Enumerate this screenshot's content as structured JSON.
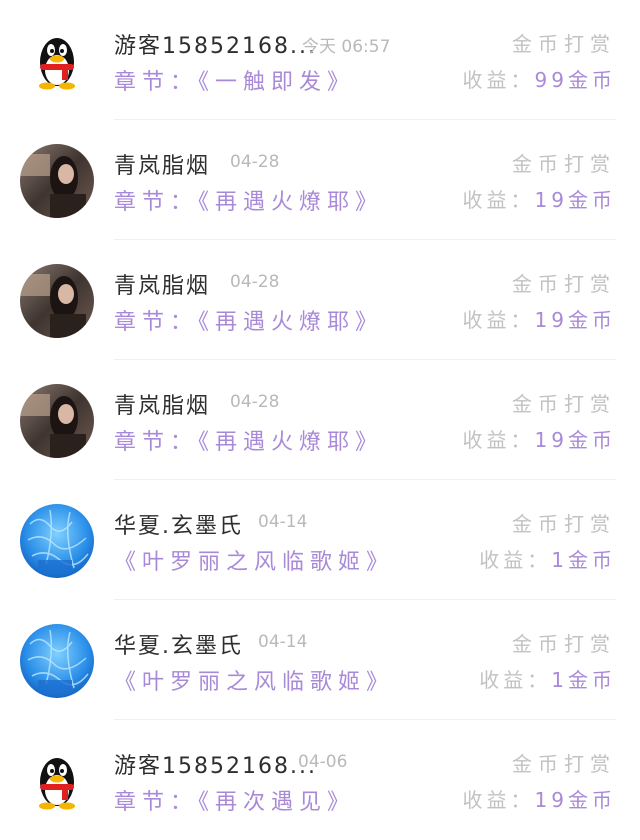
{
  "items": [
    {
      "avatar": "qq-penguin-icon",
      "name": "游客15852168...",
      "date": "今天 06:57",
      "chapter": "章节：《一触即发》",
      "type": "金币打赏",
      "earn_label": "收益：",
      "earn_amount": "99金币"
    },
    {
      "avatar": "photo-girl",
      "name": "青岚脂烟",
      "date": "04-28",
      "chapter": "章节：《再遇火燎耶》",
      "type": "金币打赏",
      "earn_label": "收益：",
      "earn_amount": "19金币"
    },
    {
      "avatar": "photo-girl",
      "name": "青岚脂烟",
      "date": "04-28",
      "chapter": "章节：《再遇火燎耶》",
      "type": "金币打赏",
      "earn_label": "收益：",
      "earn_amount": "19金币"
    },
    {
      "avatar": "photo-girl",
      "name": "青岚脂烟",
      "date": "04-28",
      "chapter": "章节：《再遇火燎耶》",
      "type": "金币打赏",
      "earn_label": "收益：",
      "earn_amount": "19金币"
    },
    {
      "avatar": "blue-pattern",
      "name": "华夏.玄墨氏",
      "date": "04-14",
      "chapter": "《叶罗丽之风临歌姬》",
      "type": "金币打赏",
      "earn_label": "收益：",
      "earn_amount": "1金币"
    },
    {
      "avatar": "blue-pattern",
      "name": "华夏.玄墨氏",
      "date": "04-14",
      "chapter": "《叶罗丽之风临歌姬》",
      "type": "金币打赏",
      "earn_label": "收益：",
      "earn_amount": "1金币"
    },
    {
      "avatar": "qq-penguin-icon",
      "name": "游客15852168...",
      "date": "04-06",
      "chapter": "章节：《再次遇见》",
      "type": "金币打赏",
      "earn_label": "收益：",
      "earn_amount": "19金币"
    }
  ]
}
